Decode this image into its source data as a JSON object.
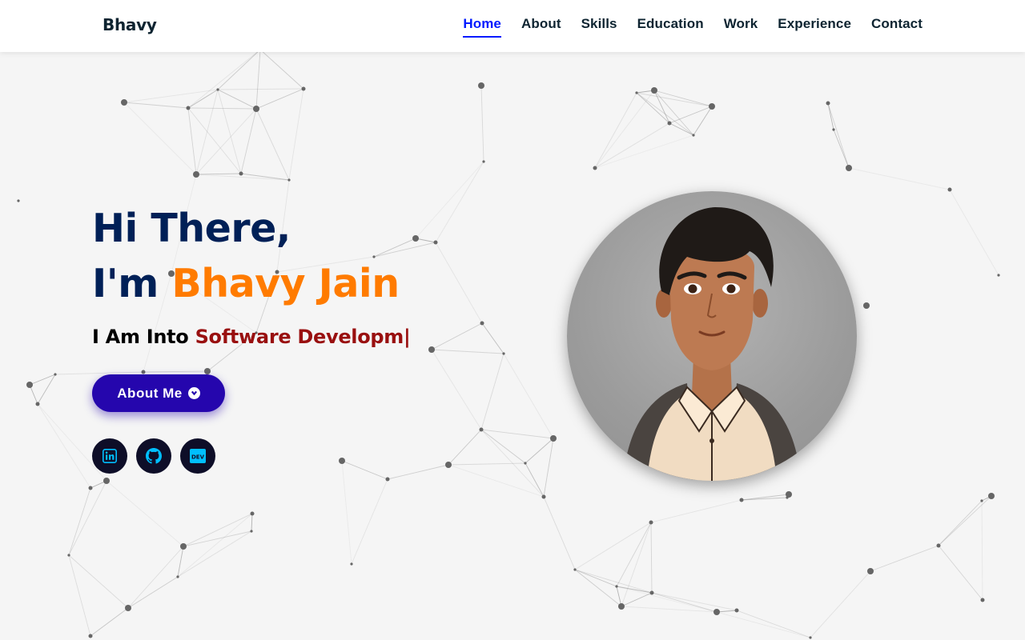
{
  "brand": {
    "logo_text": "Bhavy"
  },
  "nav": {
    "items": [
      {
        "label": "Home",
        "active": true
      },
      {
        "label": "About",
        "active": false
      },
      {
        "label": "Skills",
        "active": false
      },
      {
        "label": "Education",
        "active": false
      },
      {
        "label": "Work",
        "active": false
      },
      {
        "label": "Experience",
        "active": false
      },
      {
        "label": "Contact",
        "active": false
      }
    ]
  },
  "hero": {
    "greeting": "Hi There,",
    "im_prefix": "I'm ",
    "name": "Bhavy Jain",
    "into_prefix": "I Am Into ",
    "typed_text": "Software Developm|",
    "about_button_label": "About Me",
    "about_button_icon": "chevron-circle-down-icon"
  },
  "socials": [
    {
      "name": "LinkedIn",
      "icon": "linkedin-icon"
    },
    {
      "name": "GitHub",
      "icon": "github-icon"
    },
    {
      "name": "DEV",
      "icon": "dev-icon",
      "text": "DEV"
    }
  ],
  "colors": {
    "nav_active": "#011aff",
    "heading": "#002057",
    "name_accent": "#ff7b00",
    "typed_accent": "#991010",
    "button_bg": "#2506ad",
    "social_bg": "#0e0e28",
    "social_icon": "#00bfff",
    "page_bg": "#f5f5f5"
  }
}
